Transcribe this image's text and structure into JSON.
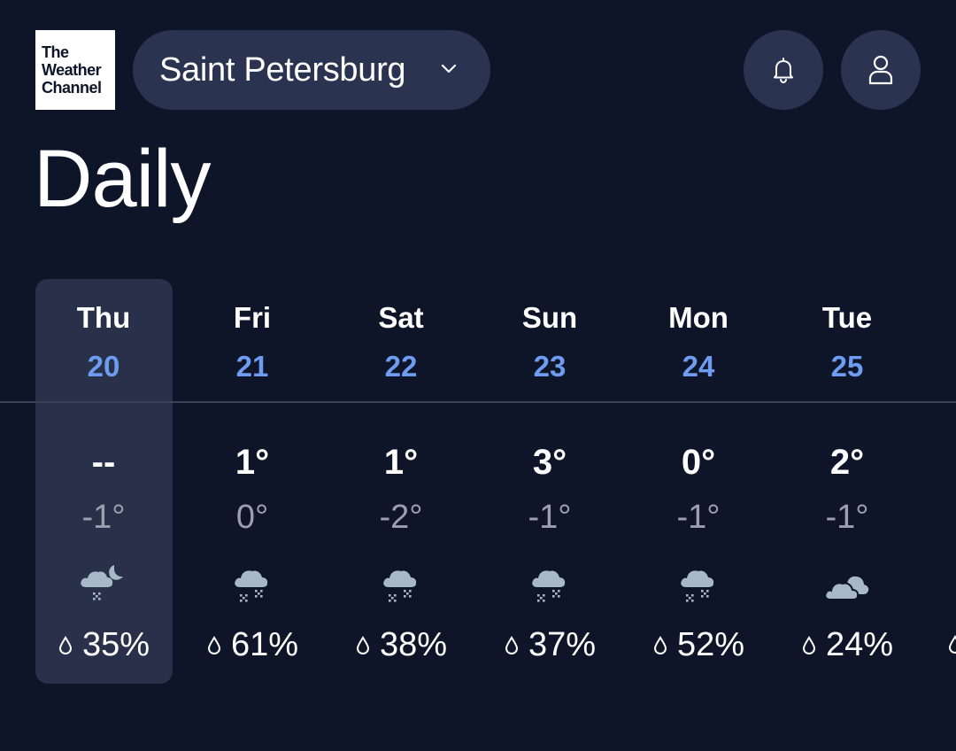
{
  "brand": {
    "line1": "The",
    "line2": "Weather",
    "line3": "Channel"
  },
  "header": {
    "location": "Saint Petersburg",
    "icons": {
      "dropdown": "chevron-down-icon",
      "notifications": "bell-icon",
      "account": "user-icon"
    }
  },
  "page": {
    "title": "Daily"
  },
  "colors": {
    "background": "#0f1529",
    "pill": "#2a3350",
    "selected_day": "#283149",
    "date_accent": "#6d9cf0",
    "low_temp": "#9aa0ad"
  },
  "days": [
    {
      "name": "Thu",
      "date": "20",
      "high": "--",
      "low": "-1°",
      "icon": "night-cloud-snow-icon",
      "precip": "35%",
      "selected": true
    },
    {
      "name": "Fri",
      "date": "21",
      "high": "1°",
      "low": "0°",
      "icon": "cloud-snow-icon",
      "precip": "61%",
      "selected": false
    },
    {
      "name": "Sat",
      "date": "22",
      "high": "1°",
      "low": "-2°",
      "icon": "cloud-snow-icon",
      "precip": "38%",
      "selected": false
    },
    {
      "name": "Sun",
      "date": "23",
      "high": "3°",
      "low": "-1°",
      "icon": "cloud-snow-icon",
      "precip": "37%",
      "selected": false
    },
    {
      "name": "Mon",
      "date": "24",
      "high": "0°",
      "low": "-1°",
      "icon": "cloud-snow-icon",
      "precip": "52%",
      "selected": false
    },
    {
      "name": "Tue",
      "date": "25",
      "high": "2°",
      "low": "-1°",
      "icon": "cloudy-icon",
      "precip": "24%",
      "selected": false
    }
  ]
}
